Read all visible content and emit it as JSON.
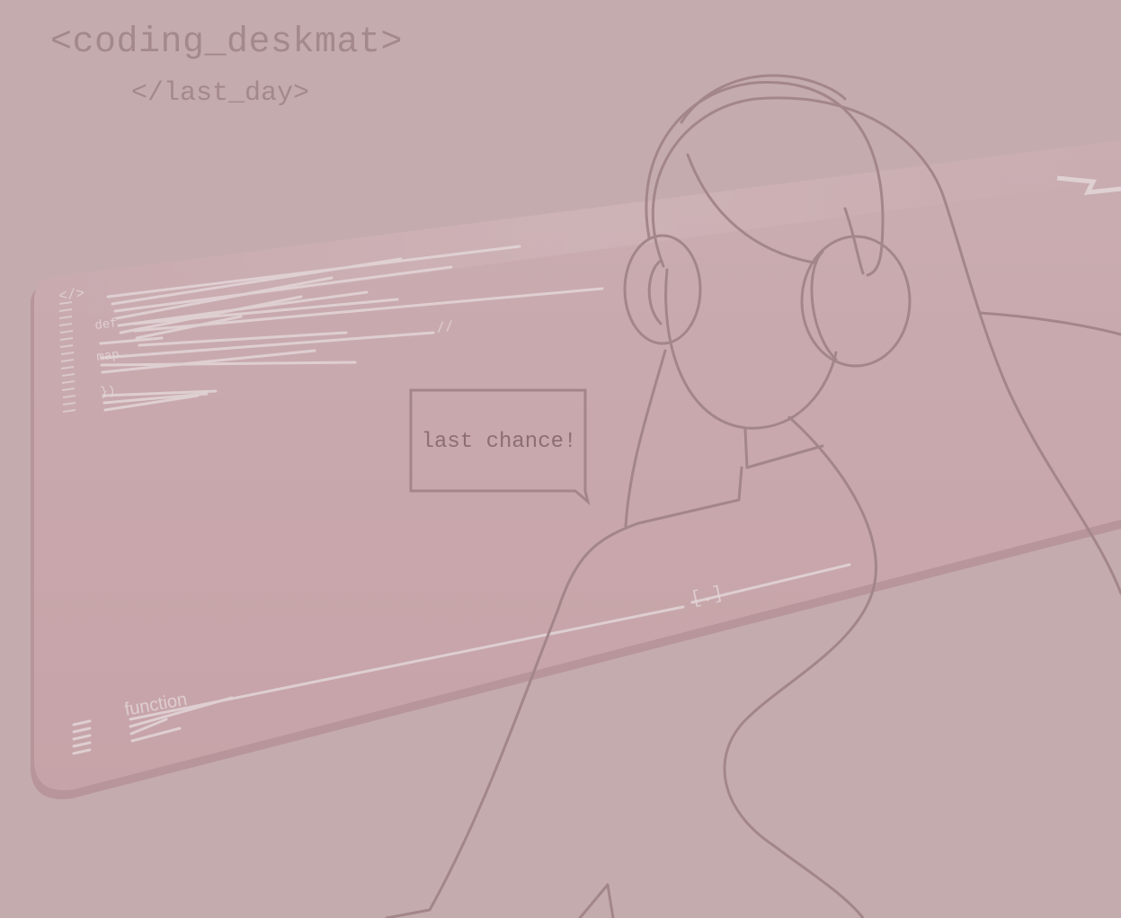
{
  "promo": {
    "headline": "<coding_deskmat>",
    "subline": "</last_day>",
    "bubble_text": "last chance!"
  },
  "mat_print": {
    "tag": "</>",
    "keyword_1": "def",
    "keyword_2": "map",
    "closing": "})",
    "comment": "//",
    "function_label": "function",
    "bracket_dot": "[.]"
  },
  "colors": {
    "background": "#c4abae",
    "mat": "#c8a9ad",
    "mat_edge": "#b8969b",
    "print": "#e8dfe0",
    "outline": "#a3868a",
    "text": "#a4898c"
  }
}
